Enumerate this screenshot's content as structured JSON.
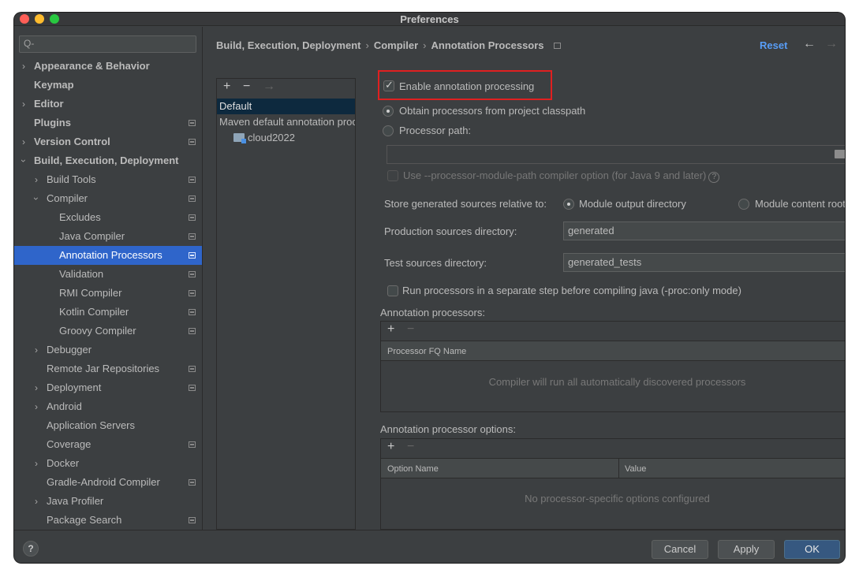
{
  "window": {
    "title": "Preferences"
  },
  "sidebar": {
    "search_placeholder": "Q-",
    "items": [
      {
        "label": "Appearance & Behavior",
        "arrow": "›"
      },
      {
        "label": "Keymap"
      },
      {
        "label": "Editor",
        "arrow": "›"
      },
      {
        "label": "Plugins"
      },
      {
        "label": "Version Control",
        "arrow": "›"
      },
      {
        "label": "Build, Execution, Deployment",
        "arrow": "›"
      },
      {
        "label": "Build Tools",
        "arrow": "›"
      },
      {
        "label": "Compiler",
        "arrow": "›"
      },
      {
        "label": "Excludes"
      },
      {
        "label": "Java Compiler"
      },
      {
        "label": "Annotation Processors"
      },
      {
        "label": "Validation"
      },
      {
        "label": "RMI Compiler"
      },
      {
        "label": "Kotlin Compiler"
      },
      {
        "label": "Groovy Compiler"
      },
      {
        "label": "Debugger",
        "arrow": "›"
      },
      {
        "label": "Remote Jar Repositories"
      },
      {
        "label": "Deployment",
        "arrow": "›"
      },
      {
        "label": "Android",
        "arrow": "›"
      },
      {
        "label": "Application Servers"
      },
      {
        "label": "Coverage"
      },
      {
        "label": "Docker",
        "arrow": "›"
      },
      {
        "label": "Gradle-Android Compiler"
      },
      {
        "label": "Java Profiler",
        "arrow": "›"
      },
      {
        "label": "Package Search"
      }
    ]
  },
  "breadcrumb": {
    "part1": "Build, Execution, Deployment",
    "part2": "Compiler",
    "part3": "Annotation Processors",
    "separator": "›"
  },
  "header": {
    "reset_label": "Reset",
    "back_glyph": "←",
    "forward_glyph": "→"
  },
  "profiles": {
    "add": "+",
    "remove": "−",
    "move": "→",
    "items": [
      "Default",
      "Maven default annotation processors profile",
      "cloud2022"
    ]
  },
  "settings": {
    "enable_label": "Enable annotation processing",
    "enable_checked": true,
    "obtain_label": "Obtain processors from project classpath",
    "processor_path_label": "Processor path:",
    "processor_path_value": "",
    "module_path_label": "Use --processor-module-path compiler option (for Java 9 and later)",
    "help_glyph": "?",
    "store_label": "Store generated sources relative to:",
    "module_output_label": "Module output directory",
    "module_content_label": "Module content root",
    "production_label": "Production sources directory:",
    "production_value": "generated",
    "test_label": "Test sources directory:",
    "test_value": "generated_tests",
    "separate_step_label": "Run processors in a separate step before compiling java (-proc:only mode)"
  },
  "processors_table": {
    "title": "Annotation processors:",
    "add": "+",
    "remove": "−",
    "column": "Processor FQ Name",
    "empty_text": "Compiler will run all automatically discovered processors"
  },
  "options_table": {
    "title": "Annotation processor options:",
    "add": "+",
    "remove": "−",
    "col_name": "Option Name",
    "col_value": "Value",
    "empty_text": "No processor-specific options configured"
  },
  "footer": {
    "help_glyph": "?",
    "cancel_label": "Cancel",
    "apply_label": "Apply",
    "ok_label": "OK"
  }
}
